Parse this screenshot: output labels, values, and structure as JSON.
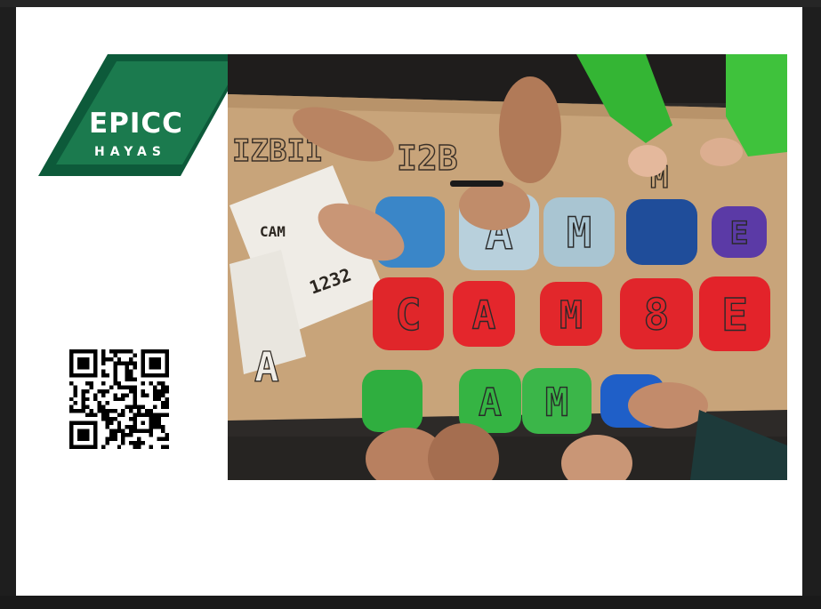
{
  "logo": {
    "word": "EPICC",
    "sub": "HAYAS",
    "colors": {
      "front": "#0d5a3a",
      "back": "#1b7a4e",
      "text": "#ffffff"
    }
  },
  "qr": {
    "icon": "qr-code-icon"
  },
  "photo": {
    "icon": "classroom-photo",
    "paper_letters": [
      "IZBII",
      "I2B",
      "CAM",
      "1232",
      "A",
      "M"
    ],
    "tiles_row1": [
      {
        "letter": "",
        "color": "#3a86c8"
      },
      {
        "letter": "A",
        "color": "#b8d0dc"
      },
      {
        "letter": "M",
        "color": "#a9c5d2"
      },
      {
        "letter": "",
        "color": "#1f4d9a"
      },
      {
        "letter": "E",
        "color": "#5b3aa6"
      }
    ],
    "tiles_row2": [
      {
        "letter": "C",
        "color": "#e0262a"
      },
      {
        "letter": "A",
        "color": "#e4262c"
      },
      {
        "letter": "M",
        "color": "#e2272b"
      },
      {
        "letter": "8",
        "color": "#e1252b"
      },
      {
        "letter": "E",
        "color": "#e3232a"
      }
    ],
    "tiles_row3": [
      {
        "letter": "",
        "color": "#2fae3f"
      },
      {
        "letter": "A",
        "color": "#35b443"
      },
      {
        "letter": "M",
        "color": "#3bb649"
      },
      {
        "letter": "",
        "color": "#1f5fc8"
      }
    ]
  }
}
